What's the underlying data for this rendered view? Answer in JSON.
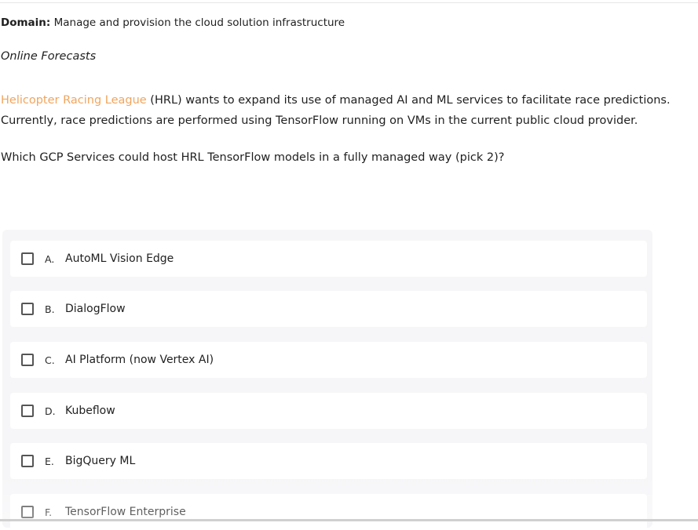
{
  "header": {
    "domain_label": "Domain:",
    "domain_value": "Manage and provision the cloud solution infrastructure"
  },
  "case_study": {
    "title": "Online Forecasts",
    "company_link": "Helicopter Racing League",
    "line1_rest": " (HRL) wants to expand its use of managed AI and ML services to facilitate race predictions.",
    "line2": "Currently, race predictions are performed using TensorFlow running on VMs in the current public cloud provider.",
    "company_link_color": "#f0a55e"
  },
  "question": {
    "text": "Which GCP Services could host HRL TensorFlow models in a fully managed way (pick 2)?"
  },
  "options": [
    {
      "letter": "A.",
      "text": "AutoML Vision Edge",
      "checked": false
    },
    {
      "letter": "B.",
      "text": "DialogFlow",
      "checked": false
    },
    {
      "letter": "C.",
      "text": "AI Platform (now Vertex AI)",
      "checked": false
    },
    {
      "letter": "D.",
      "text": "Kubeflow",
      "checked": false
    },
    {
      "letter": "E.",
      "text": "BigQuery ML",
      "checked": false
    },
    {
      "letter": "F.",
      "text": "TensorFlow Enterprise",
      "checked": false
    }
  ]
}
